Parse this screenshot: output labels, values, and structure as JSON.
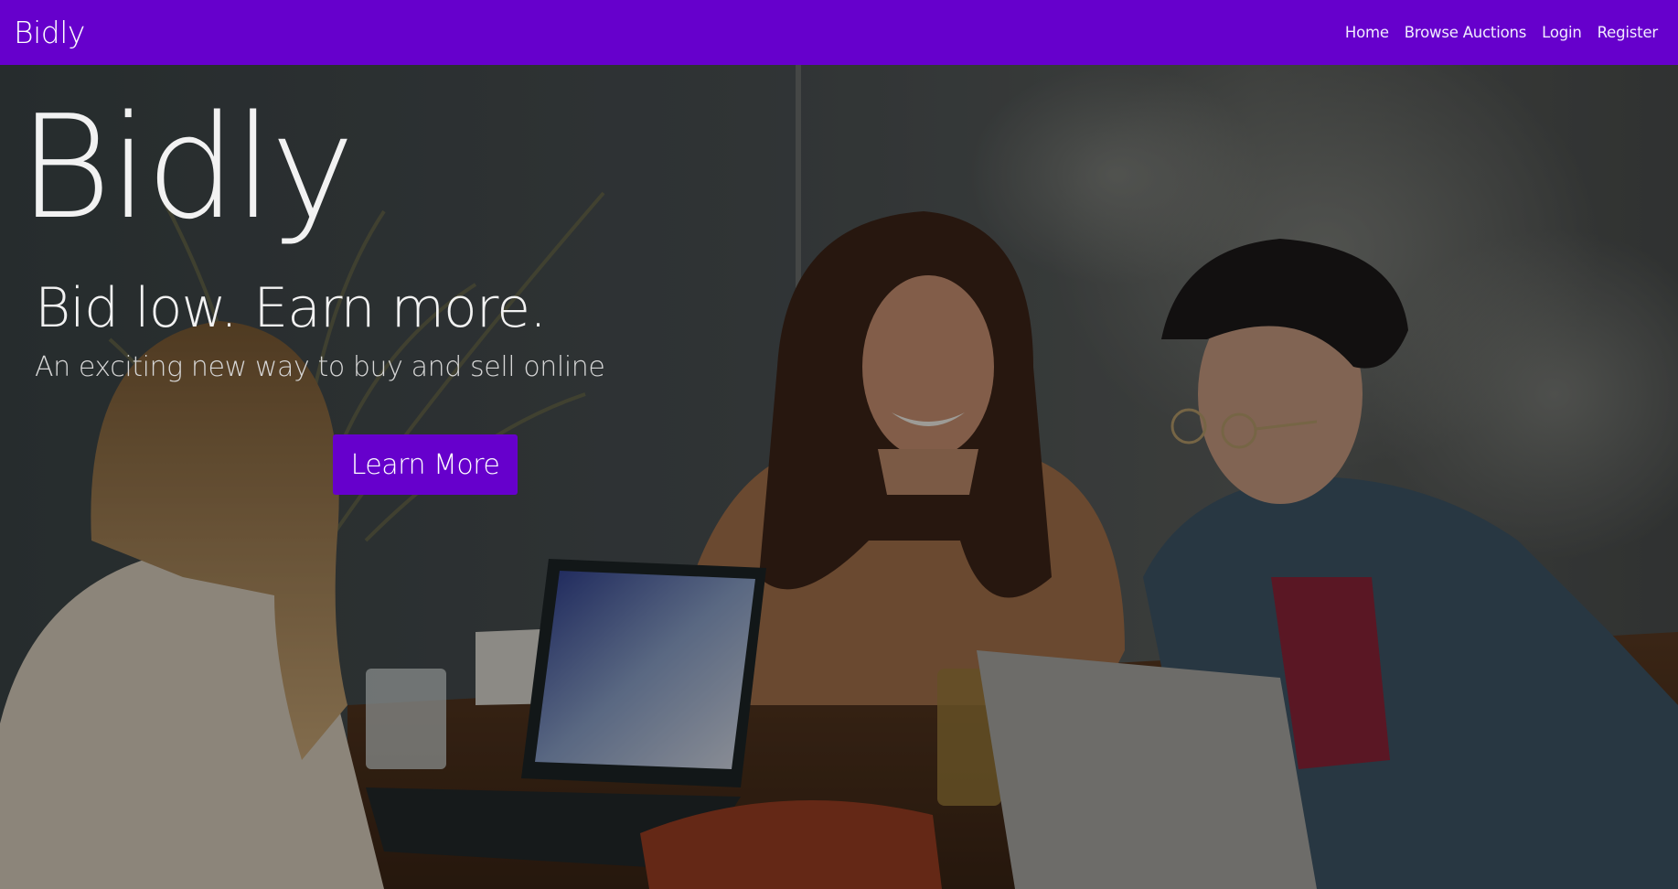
{
  "navbar": {
    "brand": "Bidly",
    "links": [
      "Home",
      "Browse Auctions",
      "Login",
      "Register"
    ]
  },
  "hero": {
    "title": "Bidly",
    "tagline": "Bid low. Earn more.",
    "subtitle": "An exciting new way to buy and sell online",
    "cta_label": "Learn More"
  },
  "colors": {
    "brand": "#6600cc",
    "text": "#f2f2f2"
  }
}
